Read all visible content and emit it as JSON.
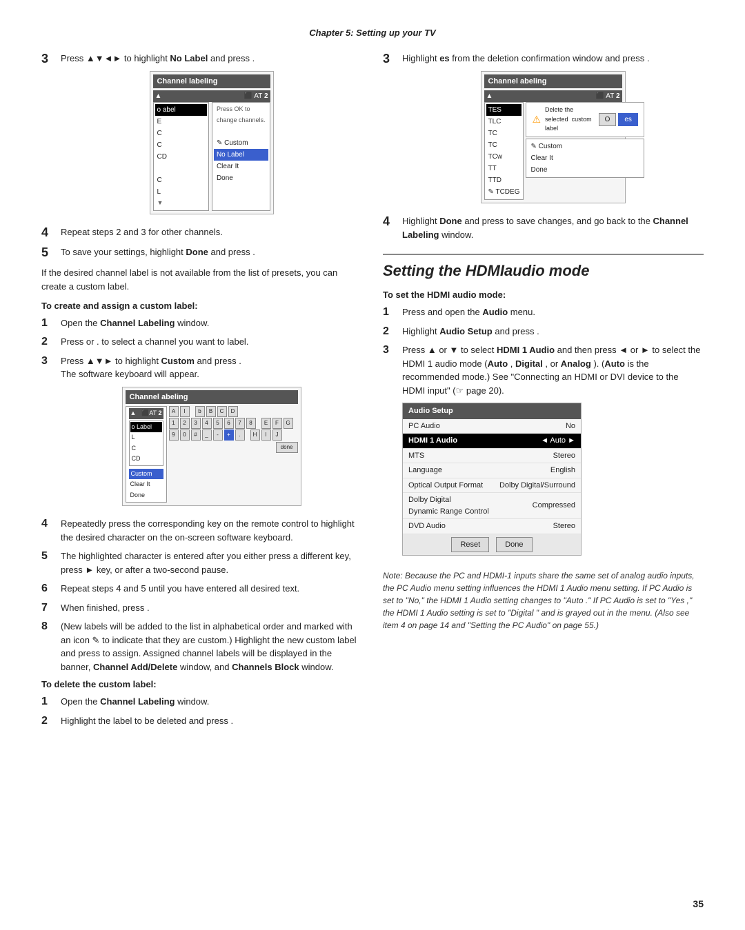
{
  "chapter_header": "Chapter 5: Setting up your TV",
  "left_column": {
    "step3_prefix": "Press ▲▼◄► to highlight ",
    "step3_bold": "No Label",
    "step3_suffix": " and press    .",
    "channel_box1": {
      "title": "Channel labeling",
      "top_bar_left": "▲",
      "top_bar_right": "AT",
      "top_bar_num": "2",
      "list_items": [
        {
          "label": "o abel",
          "highlighted": true
        },
        {
          "label": "E",
          "highlighted": false
        },
        {
          "label": "C",
          "highlighted": false
        },
        {
          "label": "C",
          "highlighted": false
        },
        {
          "label": "CD",
          "highlighted": false
        },
        {
          "label": "",
          "highlighted": false
        },
        {
          "label": "C",
          "highlighted": false
        },
        {
          "label": "L",
          "highlighted": false
        }
      ],
      "menu_items": [
        {
          "label": "Press OK to",
          "bold": false
        },
        {
          "label": "change channels.",
          "bold": false
        },
        {
          "label": "",
          "bold": false
        },
        {
          "label": "✎ Custom",
          "bold": false
        },
        {
          "label": "Clear It",
          "bold": false
        },
        {
          "label": "Done",
          "bold": false
        }
      ]
    },
    "step4": "Repeat steps 2 and 3 for other channels.",
    "step5_prefix": "To save your settings, highlight ",
    "step5_bold": "Done",
    "step5_suffix": " and press    .",
    "para1": "If the desired channel label is not available from the list of presets, you can create a custom label.",
    "subsection1": "To create and assign a custom label:",
    "sub_step1_prefix": "Open the ",
    "sub_step1_bold": "Channel Labeling",
    "sub_step1_suffix": " window.",
    "sub_step2_prefix": "Press    or   . to select a channel you want to label.",
    "sub_step3_prefix": "Press ▲▼► to highlight ",
    "sub_step3_bold": "Custom",
    "sub_step3_suffix": " and press    .",
    "sub_step3_sub": "The software keyboard will appear.",
    "channel_box2": {
      "title": "Channel abeling",
      "top_bar_left": "▲",
      "top_bar_right": "AT",
      "top_bar_num": "2",
      "list_label": "o Label"
    },
    "sub_step4": "Repeatedly press the corresponding key on the remote control to highlight the desired character on the on-screen software keyboard.",
    "sub_step5": "The highlighted character is entered after you either press a different key, press ► key, or after a two-second pause.",
    "sub_step6": "Repeat steps 4 and 5 until you have entered all desired text.",
    "sub_step7": "When finished, press    .",
    "sub_step8": "(New labels will be added to the list in alphabetical order and marked with an icon ✎ to indicate that they are custom.) Highlight the new custom label and press    to assign. Assigned channel labels will be displayed in the banner, Channel Add/Delete window, and Channels Block window.",
    "sub_step8_bold1": "Channel Add/Delete",
    "sub_step8_bold2": "Channels Block",
    "subsection2": "To delete the custom label:",
    "del_step1_prefix": "Open the ",
    "del_step1_bold": "Channel Labeling",
    "del_step1_suffix": " window.",
    "del_step2": "Highlight the label to be deleted and press    ."
  },
  "right_column": {
    "step3_prefix": "Highlight ",
    "step3_bold": "es",
    "step3_suffix": "  from the deletion confirmation window and press    .",
    "channel_box_right": {
      "title": "Channel abeling",
      "top_bar_left": "▲",
      "top_bar_right": "AT",
      "top_bar_num": "2",
      "list_items": [
        {
          "label": "TES",
          "highlighted": true
        },
        {
          "label": "TLC",
          "highlighted": false
        },
        {
          "label": "TC",
          "highlighted": false
        },
        {
          "label": "TC",
          "highlighted": false
        },
        {
          "label": "TCw",
          "highlighted": false
        },
        {
          "label": "TT",
          "highlighted": false
        },
        {
          "label": "TTD",
          "highlighted": false
        },
        {
          "label": "✎ TCDEG",
          "highlighted": false
        }
      ],
      "dialog_text": "Delete the selected   custom label",
      "dialog_btn1": "O",
      "dialog_btn2": "es",
      "menu_items": [
        {
          "label": "✎ Custom"
        },
        {
          "label": "Clear It"
        },
        {
          "label": "Done"
        }
      ]
    },
    "step4_prefix": "Highlight ",
    "step4_bold1": "Done",
    "step4_mid": " and press    to save changes, and go back to the ",
    "step4_bold2": "Channel Labeling",
    "step4_suffix": " window.",
    "section_divider": true,
    "section_title": "Setting the HDMIaudio mode",
    "subsection_hdmi": "To set the HDMI audio mode:",
    "hdmi_step1": "Press    and open the Audio menu.",
    "hdmi_step1_bold": "Audio",
    "hdmi_step2": "Highlight Audio Setup and press    .",
    "hdmi_step2_bold": "Audio Setup",
    "hdmi_step3_prefix": "Press ▲ or ▼ to select ",
    "hdmi_step3_bold1": "HDMI 1 Audio",
    "hdmi_step3_mid": "   and then press ◄ or ► to select the HDMI 1 audio mode (",
    "hdmi_step3_bold2": "Auto",
    "hdmi_step3_options": ", Digital , or Analog",
    "hdmi_step3_suffix": "). (Auto  is the recommended mode.) See \"Connecting an HDMI or DVI device to the HDMI input\" (☞ page 20).",
    "audio_box": {
      "title": "Audio Setup",
      "rows": [
        {
          "label": "PC Audio",
          "value": "No",
          "highlighted": false
        },
        {
          "label": "HDMI 1 Audio",
          "value": "Auto",
          "highlighted": true,
          "has_arrows": true
        },
        {
          "label": "MTS",
          "value": "Stereo",
          "highlighted": false
        },
        {
          "label": "Language",
          "value": "English",
          "highlighted": false
        },
        {
          "label": "Optical Output Format",
          "value": "Dolby Digital/Surround",
          "highlighted": false
        },
        {
          "label": "Dolby Digital Dynamic Range Control",
          "value": "Compressed",
          "highlighted": false
        },
        {
          "label": "DVD Audio",
          "value": "Stereo",
          "highlighted": false
        }
      ],
      "footer_btns": [
        "Reset",
        "Done"
      ]
    },
    "note_text": "Note: Because the PC and HDMI-1 inputs share the same set of analog audio inputs, the PC Audio  menu setting influences the HDMI 1 Audio  menu setting. If PC Audio  is set to \"No,\" the HDMI 1 Audio  setting changes to \"Auto .\" If PC Audio  is set to \"Yes ,\" the HDMI 1 Audio  setting is set to \"Digital \" and is grayed out in the menu. (Also see item 4 on page 14 and \"Setting the PC Audio\" on page 55.)"
  },
  "page_number": "35"
}
